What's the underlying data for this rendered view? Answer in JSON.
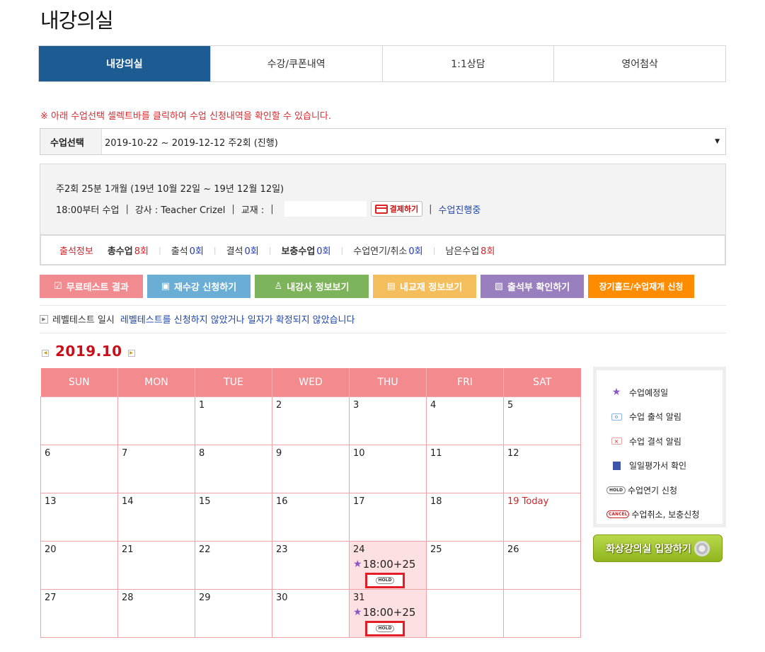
{
  "page": {
    "title": "내강의실"
  },
  "tabs": [
    {
      "label": "내강의실",
      "active": true
    },
    {
      "label": "수강/쿠폰내역",
      "active": false
    },
    {
      "label": "1:1상담",
      "active": false
    },
    {
      "label": "영어첨삭",
      "active": false
    }
  ],
  "notice": "※ 아래 수업선택 셀렉트바를 클릭하여 수업 신청내역을 확인할 수 있습니다.",
  "course_select": {
    "label": "수업선택",
    "value": "2019-10-22 ~ 2019-12-12 주2회 (진행)"
  },
  "info": {
    "line1": "주2회 25분 1개월 (19년 10월 22일 ~ 19년 12월 12일)",
    "time": "18:00부터 수업",
    "sep": "|",
    "teacher": "강사 : Teacher Crizel",
    "textbook": "교재 :",
    "pay_button": "결제하기",
    "status": "수업진행중"
  },
  "attendance": {
    "title": "출석정보",
    "items": [
      {
        "label": "총수업",
        "value": "8회",
        "bold": true,
        "color": "red"
      },
      {
        "label": "출석",
        "value": "0회",
        "bold": false,
        "color": "blue"
      },
      {
        "label": "결석",
        "value": "0회",
        "bold": false,
        "color": "blue"
      },
      {
        "label": "보충수업",
        "value": "0회",
        "bold": true,
        "color": "blue"
      },
      {
        "label": "수업연기/취소",
        "value": "0회",
        "bold": false,
        "color": "blue"
      },
      {
        "label": "남은수업",
        "value": "8회",
        "bold": false,
        "color": "red"
      }
    ]
  },
  "actions": [
    {
      "label": "무료테스트 결과",
      "color": "#f08c90",
      "icon": "checkbox-icon"
    },
    {
      "label": "재수강 신청하기",
      "color": "#6aaed6",
      "icon": "monitor-icon"
    },
    {
      "label": "내강사 정보보기",
      "color": "#7db35a",
      "icon": "person-icon"
    },
    {
      "label": "내교재 정보보기",
      "color": "#f5be5c",
      "icon": "book-icon"
    },
    {
      "label": "출석부 확인하기",
      "color": "#9a7fbf",
      "icon": "attendance-icon"
    },
    {
      "label": "장기홀드/수업재개 신청",
      "color": "#ff8c00",
      "icon": ""
    }
  ],
  "level_test": {
    "label": "레벨테스트 일시",
    "text": "레벨테스트를 신청하지 않았거나 일자가 확정되지 않았습니다"
  },
  "calendar": {
    "month": "2019.10",
    "weekdays": [
      "SUN",
      "MON",
      "TUE",
      "WED",
      "THU",
      "FRI",
      "SAT"
    ],
    "weeks": [
      [
        "",
        "",
        "1",
        "2",
        "3",
        "4",
        "5"
      ],
      [
        "6",
        "7",
        "8",
        "9",
        "10",
        "11",
        "12"
      ],
      [
        "13",
        "14",
        "15",
        "16",
        "17",
        "18",
        "19 Today"
      ],
      [
        "20",
        "21",
        "22",
        "23",
        "24",
        "25",
        "26"
      ],
      [
        "27",
        "28",
        "29",
        "30",
        "31",
        "",
        ""
      ]
    ],
    "today": "19 Today",
    "lessons": [
      {
        "week": 3,
        "day": 4,
        "time": "18:00+25",
        "hold": "HOLD"
      },
      {
        "week": 4,
        "day": 4,
        "time": "18:00+25",
        "hold": "HOLD"
      }
    ]
  },
  "legend": [
    {
      "icon": "star-icon",
      "label": "수업예정일"
    },
    {
      "icon": "attend-icon",
      "label": "수업 출석 알림"
    },
    {
      "icon": "absent-icon",
      "label": "수업 결석 알림"
    },
    {
      "icon": "evaluation-icon",
      "label": "일일평가서 확인"
    },
    {
      "icon": "hold-icon",
      "badge": "HOLD",
      "label": "수업연기 신청"
    },
    {
      "icon": "cancel-icon",
      "badge": "CANCEL",
      "label": "수업취소, 보충신청"
    }
  ],
  "enter_button": "화상강의실 입장하기"
}
